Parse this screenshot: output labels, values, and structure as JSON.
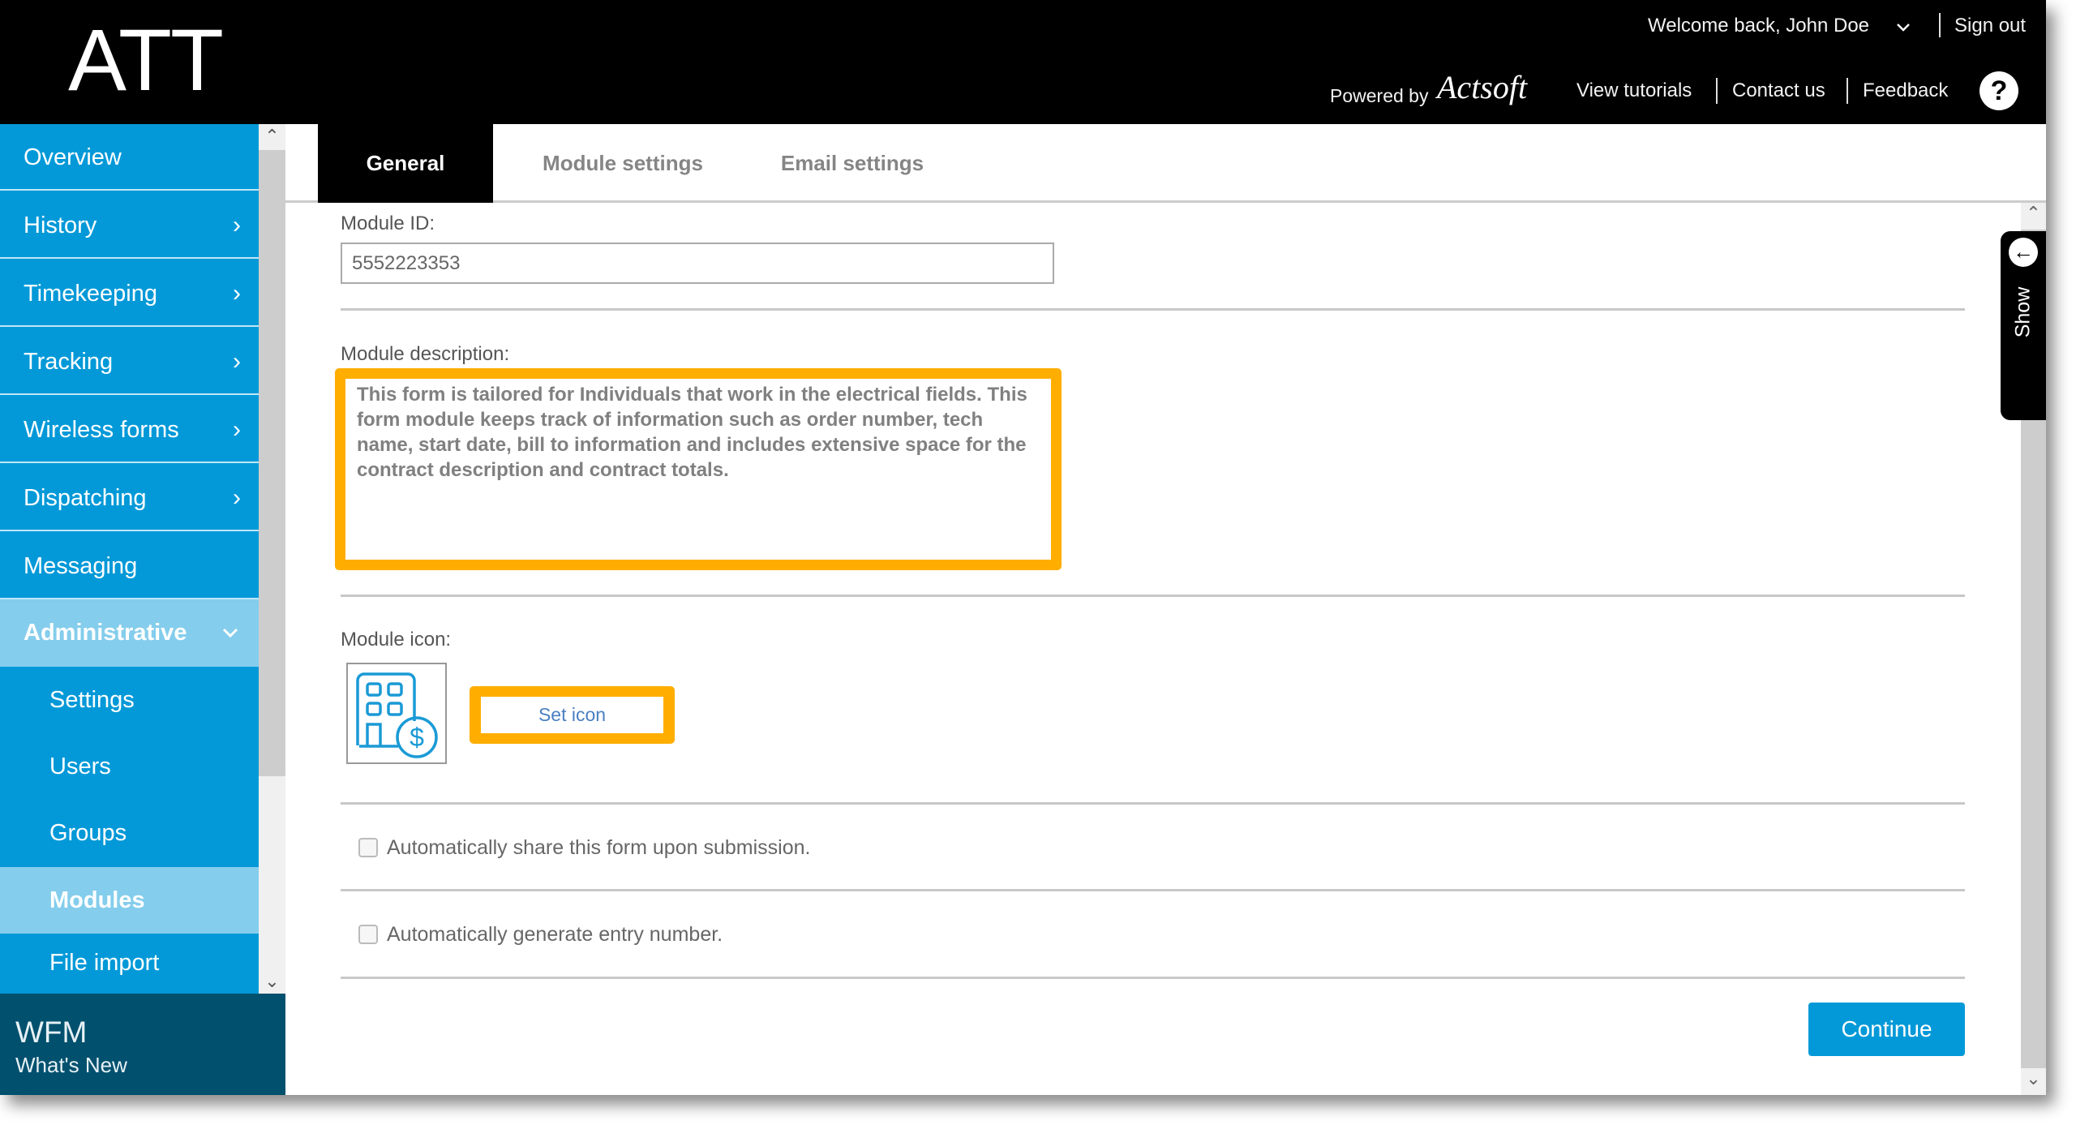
{
  "header": {
    "logo": "ATT",
    "welcome": "Welcome back, John Doe",
    "sign_out": "Sign out",
    "powered_by": "Powered by",
    "brand": "Actsoft",
    "view_tutorials": "View tutorials",
    "contact_us": "Contact us",
    "feedback": "Feedback",
    "help_icon": "?"
  },
  "sidebar": {
    "items": [
      {
        "label": "Overview",
        "chevron": ""
      },
      {
        "label": "History",
        "chevron": "›"
      },
      {
        "label": "Timekeeping",
        "chevron": "›"
      },
      {
        "label": "Tracking",
        "chevron": "›"
      },
      {
        "label": "Wireless forms",
        "chevron": "›"
      },
      {
        "label": "Dispatching",
        "chevron": "›"
      },
      {
        "label": "Messaging",
        "chevron": ""
      },
      {
        "label": "Administrative",
        "chevron": "⌄",
        "expanded": true
      },
      {
        "label": "Settings"
      },
      {
        "label": "Users"
      },
      {
        "label": "Groups"
      },
      {
        "label": "Modules",
        "selected": true
      },
      {
        "label": "File import"
      }
    ],
    "footer_title": "WFM",
    "footer_link": "What's New"
  },
  "tabs": [
    {
      "label": "General",
      "active": true
    },
    {
      "label": "Module settings"
    },
    {
      "label": "Email settings"
    }
  ],
  "form": {
    "module_id_label": "Module ID:",
    "module_id_value": "5552223353",
    "description_label": "Module description:",
    "description_value": "This form is tailored for Individuals that work in the electrical fields. This form module keeps track of information such as order number, tech name, start date, bill to information and includes extensive space for the contract description and contract totals.",
    "icon_label": "Module icon:",
    "set_icon_button": "Set icon",
    "checkbox_share": {
      "label": "Automatically share this form upon submission.",
      "checked": false
    },
    "checkbox_entry": {
      "label": "Automatically generate entry number.",
      "checked": false
    },
    "continue_button": "Continue"
  },
  "side_panel": {
    "show_label": "Show"
  },
  "colors": {
    "accent": "#0399d8",
    "highlight": "#ffae00",
    "sidebar_active": "#84cdec",
    "footer": "#00506e"
  }
}
